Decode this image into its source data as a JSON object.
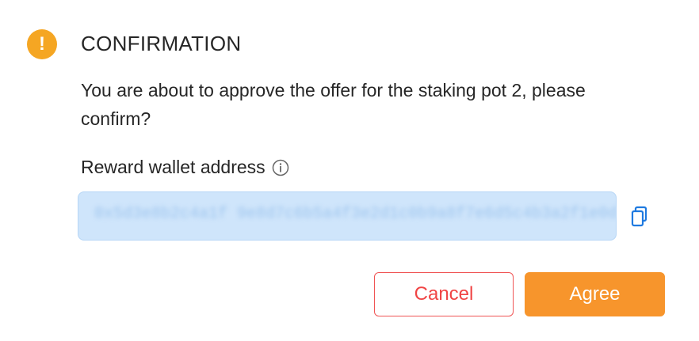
{
  "dialog": {
    "title": "CONFIRMATION",
    "message": "You are about to approve the offer for the staking pot 2, please confirm?",
    "field_label": "Reward wallet address",
    "address_value": "0x5d3e8b2c4a1f 9e8d7c6b5a4f3e2d1c0b9a8f7e6d5c4b3a2f1e0d",
    "cancel_label": "Cancel",
    "agree_label": "Agree"
  },
  "icons": {
    "warning": "warning-icon",
    "info": "info-icon",
    "copy": "copy-icon"
  },
  "colors": {
    "warning": "#f5a623",
    "cancel": "#f04444",
    "agree": "#f7952c",
    "address_bg": "#cfe5fb",
    "copy": "#1f7ae0"
  }
}
